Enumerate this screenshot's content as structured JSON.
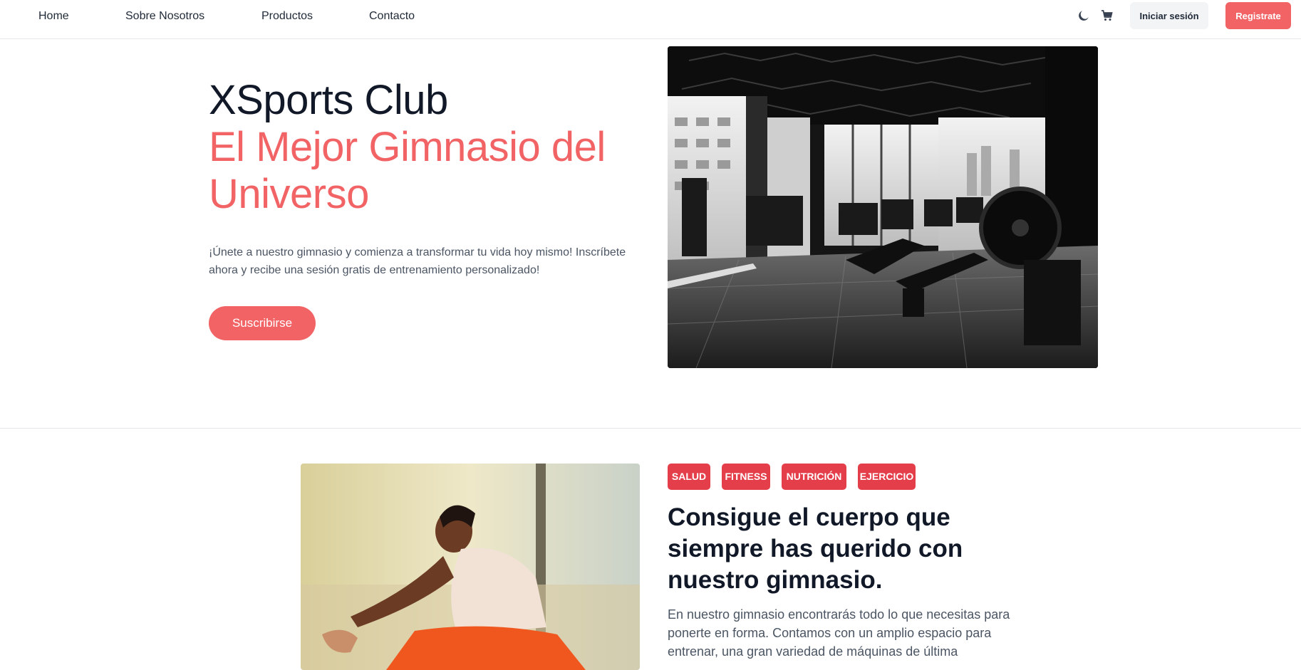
{
  "nav": {
    "links": [
      {
        "label": "Home"
      },
      {
        "label": "Sobre Nosotros"
      },
      {
        "label": "Productos"
      },
      {
        "label": "Contacto"
      }
    ],
    "icons": [
      "moon-icon",
      "cart-icon"
    ],
    "login_label": "Iniciar sesión",
    "register_label": "Registrate"
  },
  "hero": {
    "title": "XSports Club",
    "subtitle": "El Mejor Gimnasio del Universo",
    "description": "¡Únete a nuestro gimnasio y comienza a transformar tu vida hoy mismo! Inscríbete ahora y recibe una sesión gratis de entrenamiento personalizado!",
    "cta_label": "Suscribirse"
  },
  "feature": {
    "tags": [
      "SALUD",
      "FITNESS",
      "NUTRICIÓN",
      "EJERCICIO"
    ],
    "title": "Consigue el cuerpo que siempre has querido con nuestro gimnasio.",
    "description": "En nuestro gimnasio encontrarás todo lo que necesitas para ponerte en forma. Contamos con un amplio espacio para entrenar, una gran variedad de máquinas de última"
  },
  "colors": {
    "accent": "#f16365",
    "tag": "#e53e4b",
    "text_dark": "#111827",
    "text_muted": "#4b5563"
  }
}
